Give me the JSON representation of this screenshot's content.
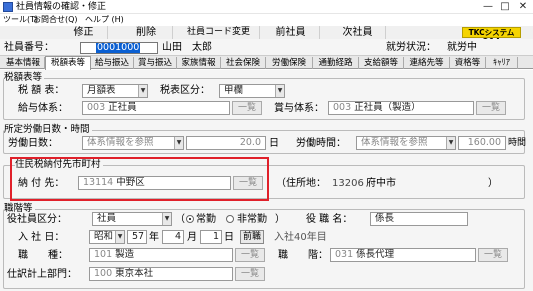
{
  "window": {
    "title": "社員情報の確認・修正",
    "minimize": "—",
    "maximize": "□",
    "close": "✕"
  },
  "menu": [
    "ツール(T)",
    "お問合せ(Q)",
    "ヘルプ (H)"
  ],
  "toolbar": {
    "buttons": [
      "修正",
      "削除",
      "社員コード変更",
      "前社員",
      "次社員"
    ],
    "help": "TKCシステムQ&A"
  },
  "header": {
    "employee_number_label": "社員番号：",
    "employee_number": "0001000",
    "employee_name": "山田　太郎",
    "status_label": "就労状況：",
    "status_value": "就労中"
  },
  "tabs": [
    "基本情報",
    "税額表等",
    "給与振込",
    "賞与振込",
    "家族情報",
    "社会保険",
    "労働保険",
    "通勤経路",
    "支給額等",
    "連絡先等",
    "資格等",
    "ｷｬﾘｱ"
  ],
  "active_tab": 1,
  "tax": {
    "section": "税額表等",
    "tax_table_label": "税 額 表：",
    "tax_table_value": "月額表",
    "tax_category_label": "税表区分：",
    "tax_category_value": "甲欄",
    "salary_system_label": "給与体系：",
    "salary_system_code": "003",
    "salary_system_name": "正社員",
    "bonus_system_label": "賞与体系：",
    "bonus_system_code": "003",
    "bonus_system_name": "正社員（製造）",
    "lookup": "一覧"
  },
  "work": {
    "section": "所定労働日数・時間",
    "days_label": "労働日数：",
    "days_source": "体系情報を参照",
    "days_value": "20.0",
    "days_unit": "日",
    "hours_label": "労働時間：",
    "hours_source": "体系情報を参照",
    "hours_value": "160.00",
    "hours_unit": "時間"
  },
  "residence": {
    "section": "住民税納付先市町村",
    "pay_to_label": "納 付 先：",
    "pay_to_code": "13114",
    "pay_to_name": "中野区",
    "lookup": "一覧",
    "address_label": "（住所地：",
    "address_code": "13206",
    "address_name": "府中市",
    "address_close": "）"
  },
  "position": {
    "section": "職階等",
    "exec_label": "役社員区分：",
    "exec_value": "社員",
    "fulltime_open": "（",
    "fulltime": "常勤",
    "parttime": "非常勤",
    "fulltime_close": "）",
    "title_label": "役 職 名：",
    "title_value": "係長",
    "join_label": "入 社 日：",
    "era": "昭和",
    "year": "57",
    "year_unit": "年",
    "month": "4",
    "month_unit": "月",
    "day": "1",
    "day_unit": "日",
    "before_btn": "前職",
    "tenure": "入社40年目",
    "type_label": "職　　種：",
    "type_code": "101",
    "type_name": "製造",
    "level_label": "職　　階：",
    "level_code": "031",
    "level_name": "係長代理",
    "dept_label": "仕訳計上部門：",
    "dept_code": "100",
    "dept_name": "東京本社",
    "lookup": "一覧"
  },
  "colors": {
    "highlight": "#e0202a",
    "selection": "#0a5fd2",
    "help_button": "#f5d400"
  }
}
